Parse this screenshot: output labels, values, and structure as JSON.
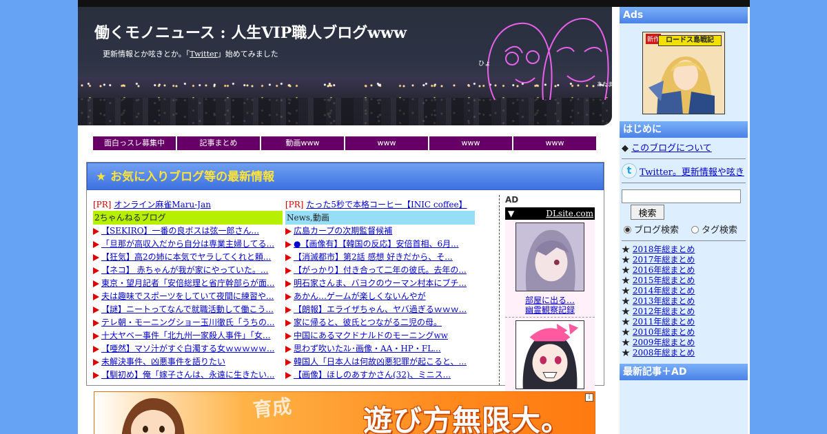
{
  "header": {
    "site_title": "働くモノニュース : 人生VIP職人ブログwww",
    "desc_before": "更新情報とか呟きとか。「",
    "desc_link": "Twitter",
    "desc_after": "」始めてみました"
  },
  "nav": [
    "面白っスレ募集中",
    "記事まとめ",
    "動画www",
    "www",
    "www",
    "www"
  ],
  "main": {
    "title": "★ お気に入りブログ等の最新情報",
    "col1": {
      "pr_tag": "[PR]",
      "pr_link": "オンライン麻雀Maru-Jan",
      "category": "2ちゃんねるブログ",
      "items": [
        "【SEKIRO】一番の良ボスは弦一郎さん...",
        "「旦那が高収入だから自分は専業主婦してる...",
        "【狂気】高2の姉に本気でヤラしてくれと頼...",
        "【ネコ】 赤ちゃんが我が家にやっていた。...",
        "東京・望月記者「安倍総理と省庁幹部らが面...",
        "夫は趣味でスポーツをしていて夜間に練習や...",
        "【謎】ニートってなんで就職活動して働こう...",
        "テレ朝・モーニングショー玉川徹氏「うちの...",
        "十大ヤベー事件「北九州一家殺人事件」「女...",
        "【唖然】マソ汁がすぐ白濁する女ｗｗｗｗｗ...",
        "未解決事件、凶悪事件を語りたい",
        "【馴初め】俺「嫁子さんは、永遠に生きたい..."
      ]
    },
    "col2": {
      "pr_tag": "[PR]",
      "pr_link": "たった5秒で本格コーヒー【INIC coffee】",
      "category": "News,動画",
      "items": [
        "広島カープの次期監督候補",
        "●【画像有】【韓国の反応】安倍首相、6月...",
        "【消滅都市】第2話 感想 好きだから、そ...",
        "【がっかり】付き合って二年の彼氏。去年の...",
        "明石家さんま、バヨクのウーマン村本にブチ...",
        "あかん…ゲームが楽しくないんやが",
        "【朗報】エライザちゃん、ヤバ過ぎるｗｗｗ...",
        "家に帰ると、彼氏とつながる二児の母。",
        "中国にあるマクドナルドのモーニングww",
        "思わず吹いたｽﾚ･画像・AA・HP・FL...",
        "韓国人「日本人は何故凶悪犯罪が起こると、...",
        "【画像】ほしのあすかさん(32)、ミニス..."
      ]
    },
    "ad": {
      "label": "AD",
      "bar_arrow": "▼",
      "bar_link": "DLsite.com",
      "items": [
        {
          "caption1": "部屋に出る…",
          "caption2": "幽霊観察記録"
        }
      ]
    }
  },
  "banner": {
    "main_text": "遊び方無限大。",
    "sub_text": "育成",
    "info": "i"
  },
  "sidebar": {
    "ads_head": "Ads",
    "ads_badge": "新作",
    "ads_title": "ロードス島戦記",
    "intro_head": "はじめに",
    "about_bullet": "◆",
    "about_link": "このブログについて",
    "tw_icon": "t",
    "tw_link": "Twitter。更新情報や呟き",
    "search_value": "",
    "search_button": "検索",
    "radio_blog": "ブログ検索",
    "radio_tag": "タグ検索",
    "years": [
      "2018年総まとめ",
      "2017年総まとめ",
      "2016年総まとめ",
      "2015年総まとめ",
      "2014年総まとめ",
      "2013年総まとめ",
      "2012年総まとめ",
      "2011年総まとめ",
      "2010年総まとめ",
      "2009年総まとめ",
      "2008年総まとめ"
    ],
    "latest_head": "最新記事＋AD"
  },
  "colors": {
    "background": "#66a3f5",
    "nav": "#660066",
    "cat1": "#b6f000",
    "cat2": "#96ddf6",
    "title_yellow": "#ffe23a",
    "arrow_red": "#e00000"
  }
}
